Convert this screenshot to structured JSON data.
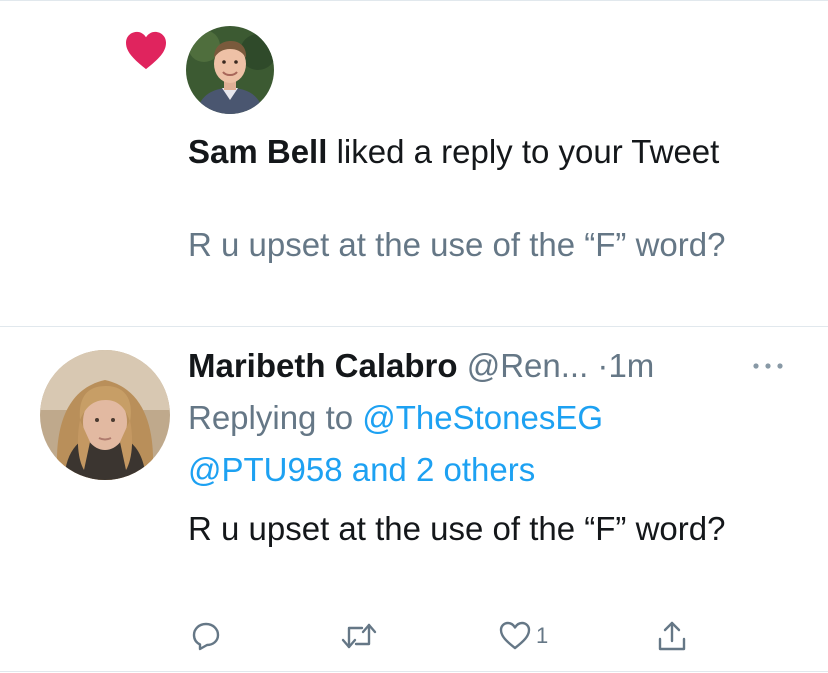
{
  "notification": {
    "actor_name": "Sam Bell",
    "action_text": " liked a reply to your Tweet",
    "preview_text": "R u upset at the use of the “F” word?",
    "heart_color": "#e0245e",
    "icon": "heart-icon"
  },
  "tweet": {
    "author_name": "Maribeth Calabro",
    "author_handle": "@Ren...",
    "timestamp": "1m",
    "separator": " ·",
    "replying_prefix": "Replying to ",
    "replying_to_1": "@TheStonesEG",
    "replying_to_2": "@PTU958 and 2 others",
    "body": "R u upset at the use of the “F” word?",
    "more_icon": "more-icon"
  },
  "actions": {
    "reply_icon": "reply-icon",
    "retweet_icon": "retweet-icon",
    "like_icon": "like-icon",
    "like_count": "1",
    "share_icon": "share-icon"
  },
  "colors": {
    "link": "#1da1f2",
    "secondary_text": "#657786",
    "primary_text": "#14171a",
    "divider": "#e1e8ed"
  }
}
